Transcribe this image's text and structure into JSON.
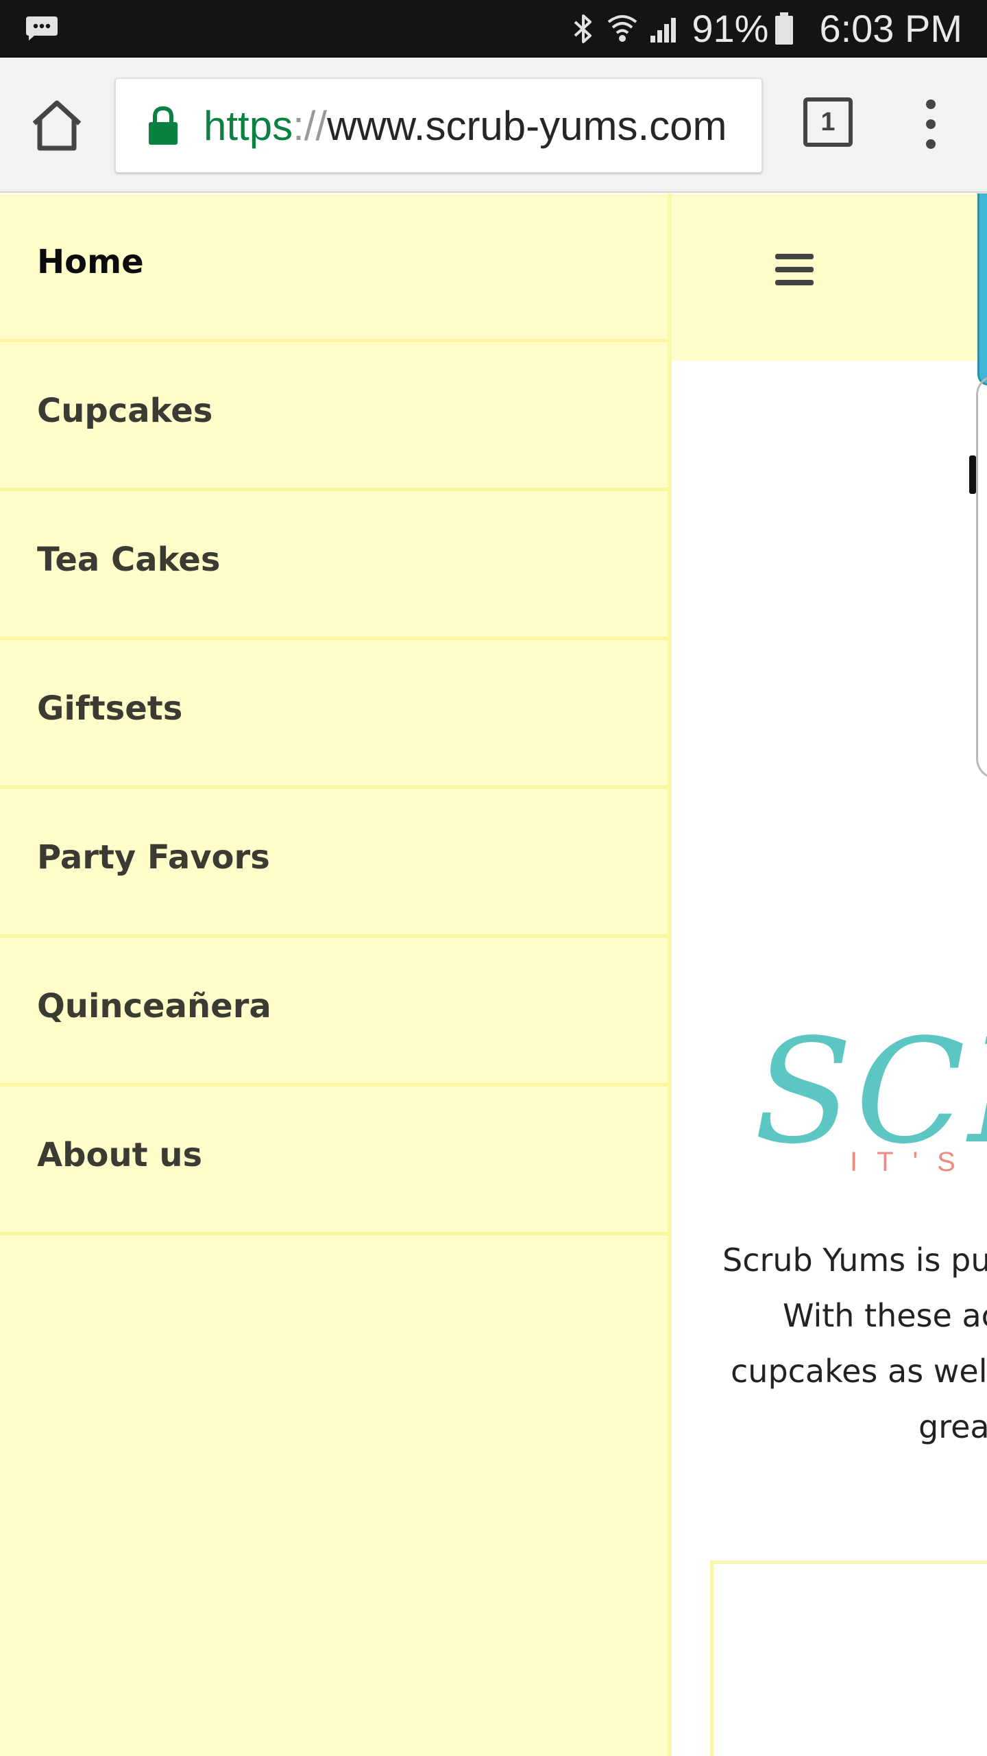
{
  "status_bar": {
    "icons": [
      "notification-message-icon",
      "bluetooth-icon",
      "wifi-icon",
      "cell-signal-icon",
      "battery-icon"
    ],
    "battery": "91%",
    "time": "6:03 PM"
  },
  "browser": {
    "url_scheme": "https",
    "url_separator": "://",
    "url_host": "www.scrub-yums.com",
    "tab_count": "1",
    "colors": {
      "secure": "#0b8043",
      "toolbar": "#f2f2f2"
    }
  },
  "drawer": {
    "background": "#fffdc9",
    "items": [
      {
        "label": "Home",
        "active": true
      },
      {
        "label": "Cupcakes"
      },
      {
        "label": "Tea Cakes"
      },
      {
        "label": "Giftsets"
      },
      {
        "label": "Party Favors"
      },
      {
        "label": "Quinceañera"
      },
      {
        "label": "About us"
      }
    ]
  },
  "main": {
    "menu_icon": "hamburger-icon",
    "logo": {
      "wordmark": "SCRUB YUMS",
      "tagline": "IT'S"
    },
    "intro_lines": [
      "Scrub Yums is pu",
      "With these ac",
      "cupcakes as well",
      "grea"
    ],
    "colors": {
      "logo": "#5cc6c2",
      "tagline": "#ef8b80",
      "cart_tab": "#3fb7d6"
    }
  }
}
